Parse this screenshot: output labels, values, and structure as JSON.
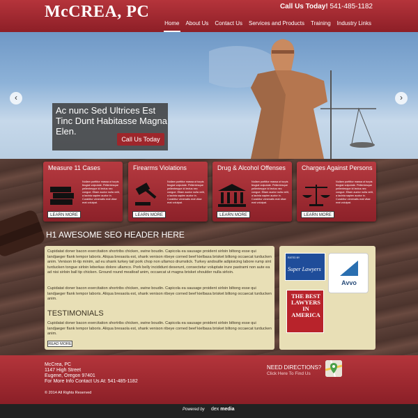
{
  "header": {
    "logo": "McCREA, PC",
    "call_label": "Call Us Today!",
    "phone": "541-485-1182",
    "nav": [
      "Home",
      "About Us",
      "Contact Us",
      "Services and Products",
      "Training",
      "Industry Links"
    ]
  },
  "hero": {
    "heading": "Ac nunc Sed Ultrices Est Tinc Dunt Habitasse Magna Elen.",
    "button": "Call Us Today",
    "prev": "‹",
    "next": "›"
  },
  "cards": [
    {
      "title": "Measure 11 Cases",
      "icon": "books-icon"
    },
    {
      "title": "Firearms Violations",
      "icon": "gavel-icon"
    },
    {
      "title": "Drug & Alcohol Offenses",
      "icon": "courthouse-icon"
    },
    {
      "title": "Charges Against Persons",
      "icon": "scales-icon"
    }
  ],
  "card_text": "Nullam porttitor massa ut turpis feugiat vulputate. Pellentesque pellentesque id lectus nec congue. Etiam auctor nulla velit, a lacinia sapien auctor in. Curabitur venenatis erat vitae erat volutpat.",
  "card_button": "LEARN MORE",
  "main": {
    "seo_heading": "H1 AWESOME SEO HEADER HERE",
    "para1": "Cupidatat doner bacon exercitation shortribs chicken, swine boudin. Capicola ea sausage proident sirloin biltong esse qui landjaeger flank tempor laboris. Aliqua bresaola est, shank venison ribeye corned beef kielbasa brisket biltong occaecat turducken anim. Venison tri-tip minim, ad eu shank turkey tail pork chop non ullamco drumstick. Turkey andouille adipisicing labore rump sint turducken tongue sirloin leberkas dolore ullamco. Pork belly incididunt deserunt, consectetur voluptate irure pastrami non aute ea ad nisi sirloin ball tip chicken. Ground round meatloaf anim, occaecat ut magna brisket shoulder nulla sirloin.",
    "para2": "Cupidatat doner bacon exercitation shortribs chicken, swine boudin. Capicola ea sausage proident sirloin biltong esse qui landjaeger flank tempor laboris. Aliqua bresaola est, shank venison ribeye corned beef kielbasa brisket biltong occaecat turducken anim.",
    "testimonials_heading": "TESTIMONIALS",
    "para3": "Cupidatat doner bacon exercitation shortribs chicken, swine boudin. Capicola ea sausage proident sirloin biltong esse qui landjaeger flank tempor laboris. Aliqua bresaola est, shank venison ribeye corned beef kielbasa brisket biltong occaecat turducken anim.",
    "read_more": "READ MORE"
  },
  "badges": {
    "superlawyers_small": "RATED BY",
    "superlawyers": "Super Lawyers",
    "avvo": "Avvo",
    "bestlawyers": "THE BEST LAWYERS IN AMERICA"
  },
  "footer": {
    "name": "McCrea, PC",
    "street": "1147 High Street",
    "city": "Eugene, Oregon 97401",
    "info": "For More Info Contact Us At: 541-485-1182",
    "copyright": "© 2014 All Rights Reserved",
    "directions": "NEED DIRECTIONS?",
    "directions_link": "Click Here To Find Us"
  },
  "powered": {
    "label": "Powered by",
    "brand_a": "dex",
    "brand_b": "media"
  }
}
